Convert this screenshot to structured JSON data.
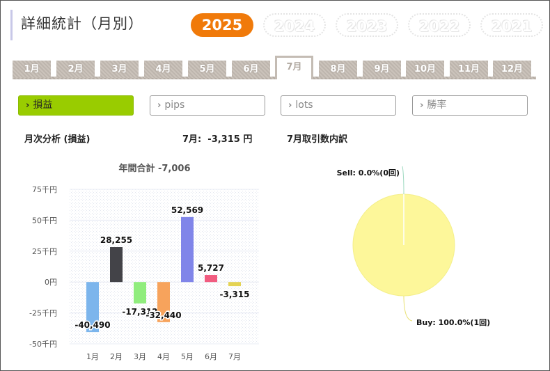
{
  "header": {
    "title": "詳細統計（月別）"
  },
  "years": [
    {
      "label": "2025",
      "active": true
    },
    {
      "label": "2024",
      "active": false
    },
    {
      "label": "2023",
      "active": false
    },
    {
      "label": "2022",
      "active": false
    },
    {
      "label": "2021",
      "active": false
    }
  ],
  "months": [
    "1月",
    "2月",
    "3月",
    "4月",
    "5月",
    "6月",
    "7月",
    "8月",
    "9月",
    "10月",
    "11月",
    "12月"
  ],
  "active_month": "7月",
  "metric_tabs": [
    {
      "label": "損益",
      "active": true
    },
    {
      "label": "pips",
      "active": false
    },
    {
      "label": "lots",
      "active": false
    },
    {
      "label": "勝率",
      "active": false
    }
  ],
  "summary": {
    "monthly_analysis_label": "月次分析 (損益)",
    "current_month_value": "7月:  -3,315 円",
    "trade_breakdown_label": "7月取引数内訳"
  },
  "colors": {
    "accent": "#f07a0a",
    "active_tab": "#99cc00"
  },
  "chart_data": [
    {
      "type": "bar",
      "title": "年間合計 -7,006",
      "categories": [
        "1月",
        "2月",
        "3月",
        "4月",
        "5月",
        "6月",
        "7月"
      ],
      "values": [
        -40490,
        28255,
        -17312,
        -32440,
        52569,
        5727,
        -3315
      ],
      "value_labels": [
        "-40,490",
        "28,255",
        "-17,312",
        "-32,440",
        "52,569",
        "5,727",
        "-3,315"
      ],
      "colors": [
        "#7cb5ec",
        "#434348",
        "#90ed7d",
        "#f7a35c",
        "#8085e9",
        "#f15c80",
        "#e4d354"
      ],
      "yticks": [
        75000,
        50000,
        25000,
        0,
        -25000,
        -50000
      ],
      "ytick_labels": [
        "75千円",
        "50千円",
        "25千円",
        "0円",
        "-25千円",
        "-50千円"
      ],
      "ylim": [
        -50000,
        75000
      ]
    },
    {
      "type": "pie",
      "slices": [
        {
          "name": "Sell",
          "label": "Sell: 0.0%(0回)",
          "value": 0,
          "color": "#9ed9c0"
        },
        {
          "name": "Buy",
          "label": "Buy: 100.0%(1回)",
          "value": 100,
          "color": "#fdf79a"
        }
      ]
    }
  ]
}
